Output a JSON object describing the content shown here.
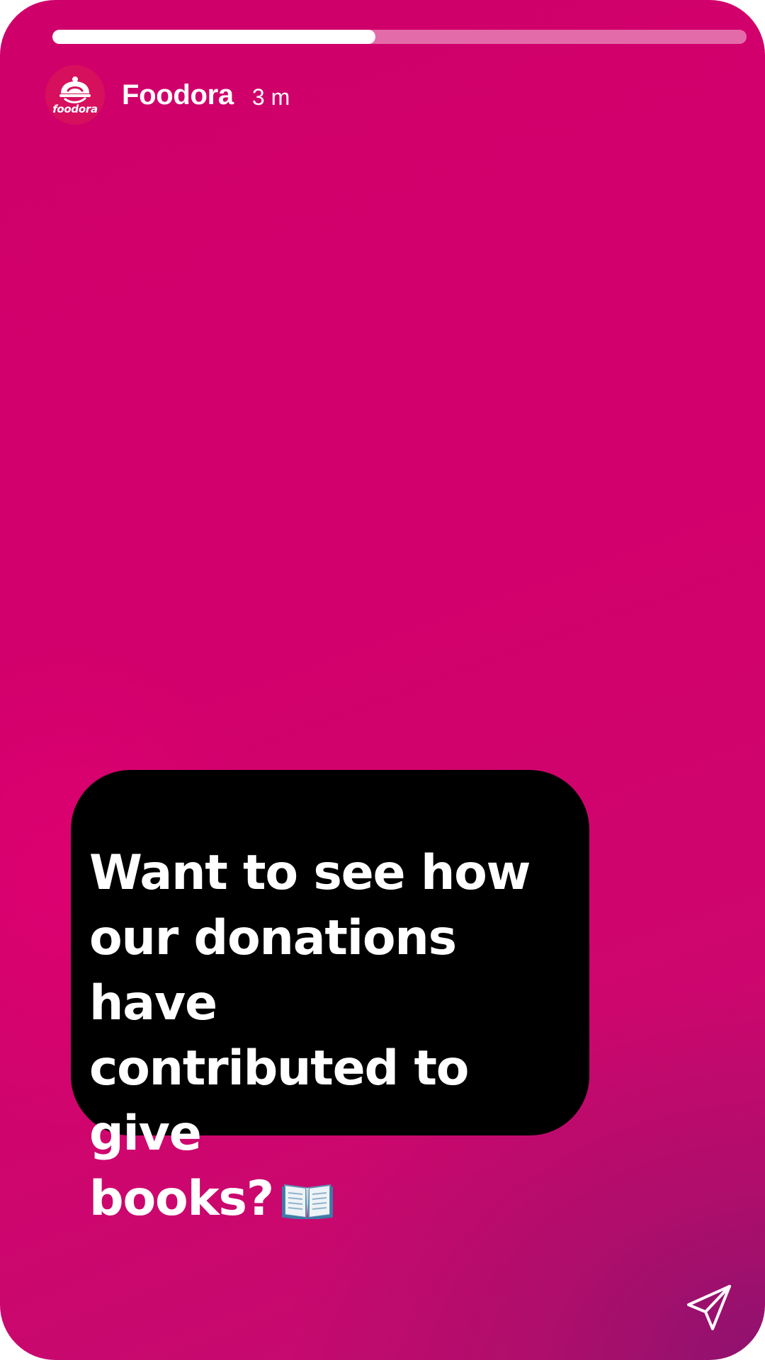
{
  "story": {
    "progress": 0.465,
    "account_name": "Foodora",
    "time_ago": "3 m",
    "avatar": {
      "logo_text": "foodora",
      "icon": "cloche-icon",
      "color": "#d7105e"
    },
    "caption": {
      "text": "Want to see how\nour donations have\ncontributed to give\nbooks?",
      "emoji_icon": "open-book-icon"
    },
    "share_icon": "paper-plane-icon",
    "colors": {
      "background_primary": "#d0006b",
      "background_corner": "#9a1470",
      "caption_background": "#000000",
      "text": "#ffffff"
    }
  }
}
